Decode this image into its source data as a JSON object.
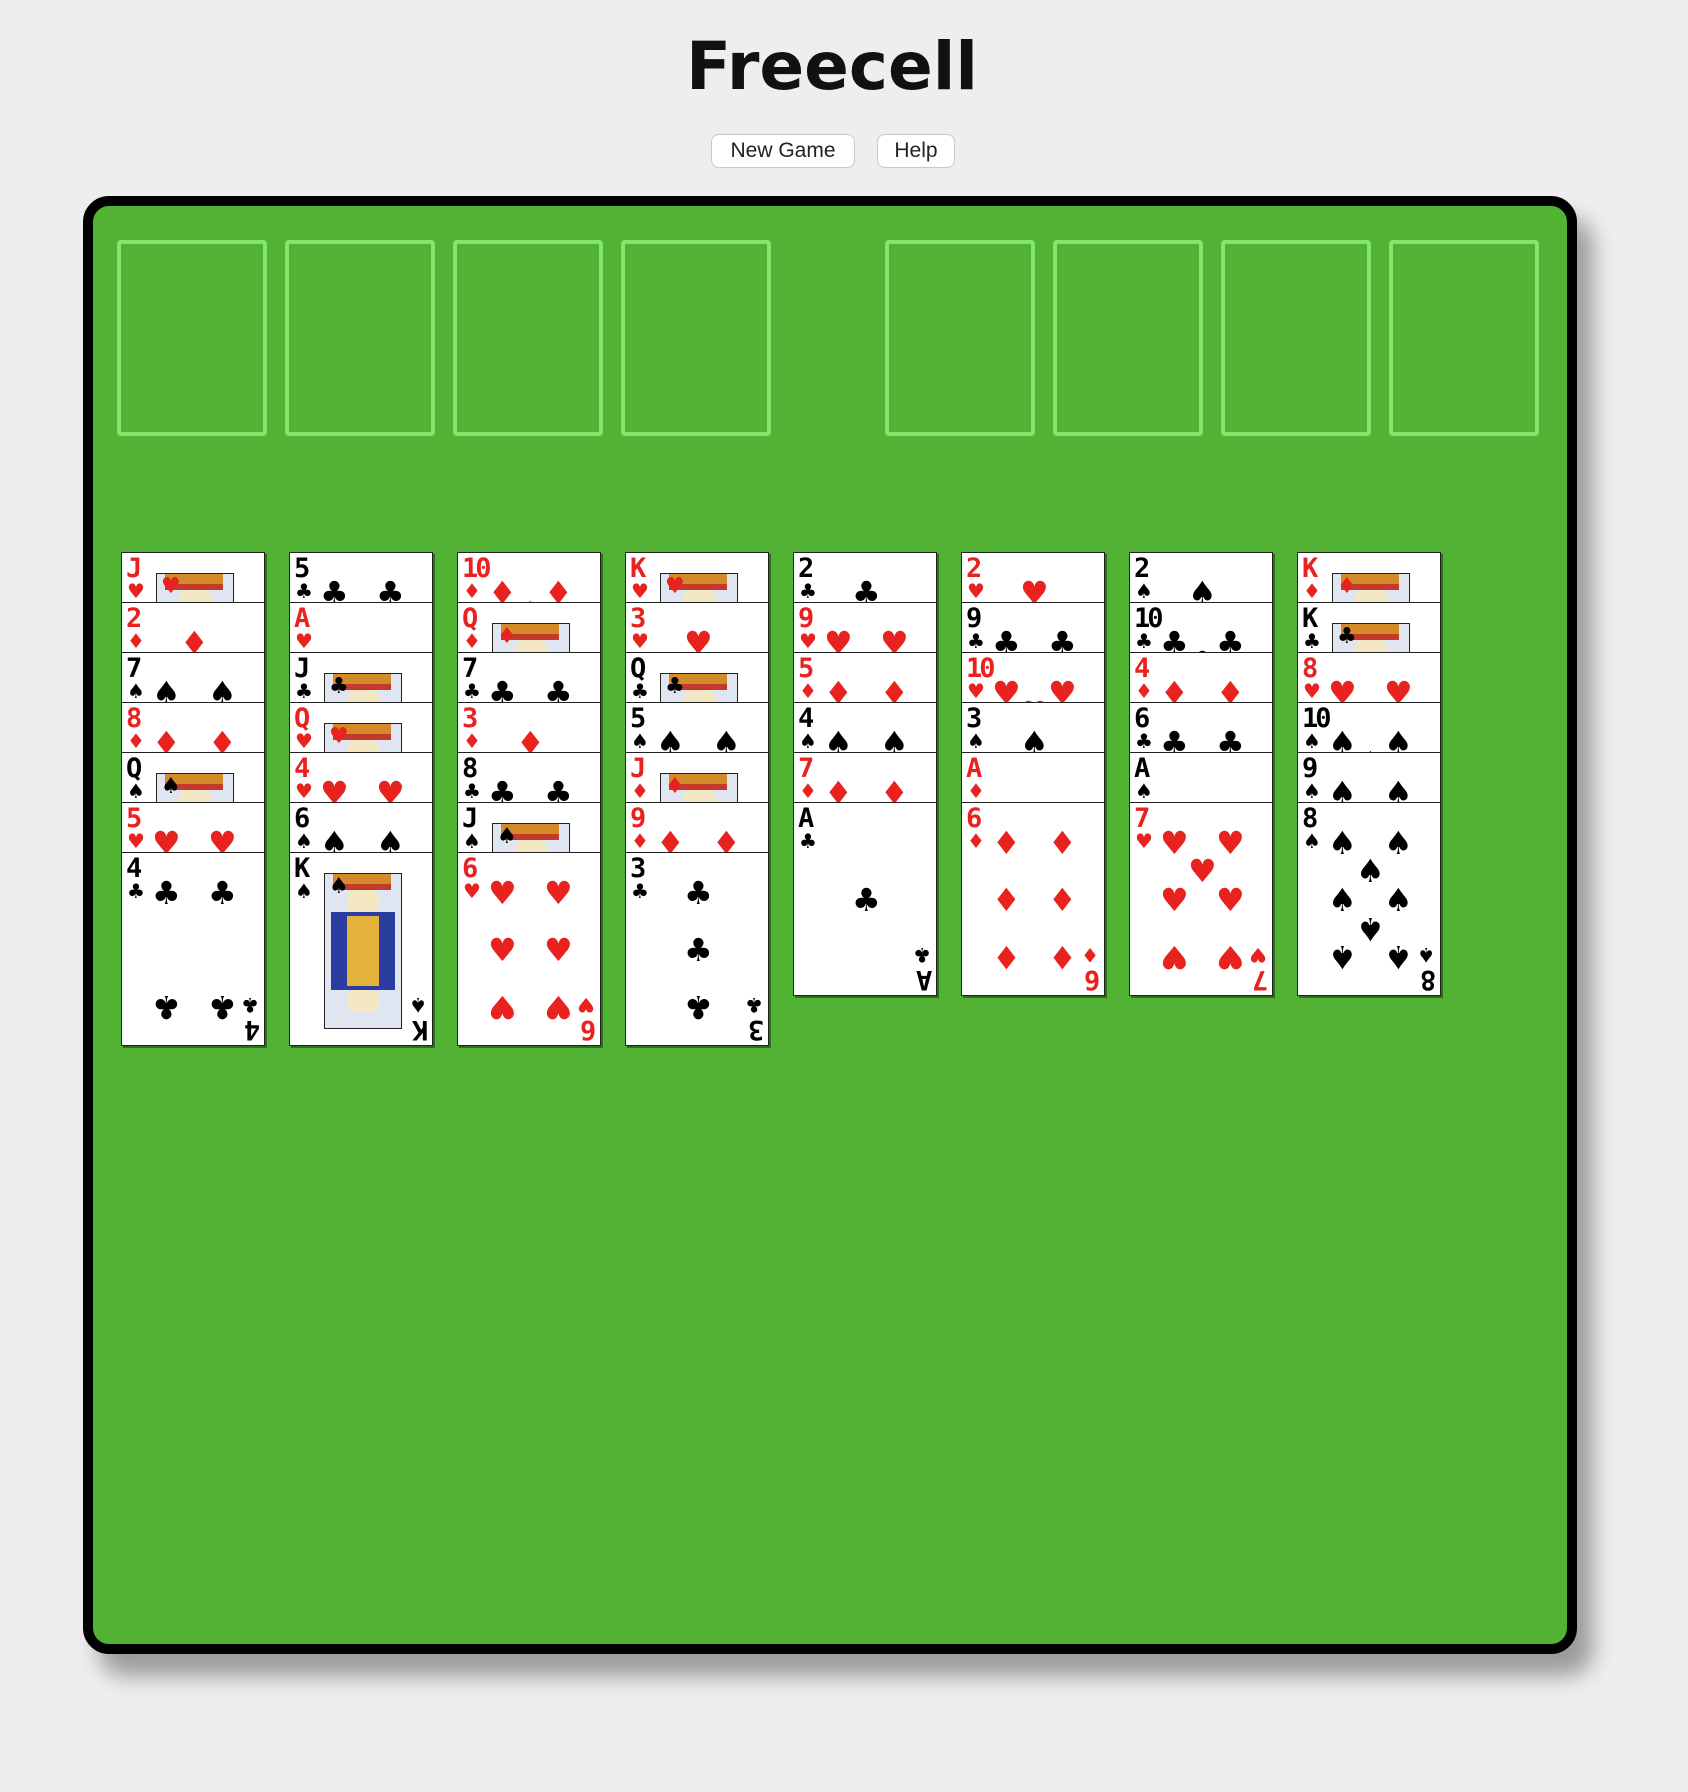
{
  "title": "Freecell",
  "buttons": {
    "new_game": "New Game",
    "help": "Help"
  },
  "free_cells": [
    {
      "name": "freecell-1"
    },
    {
      "name": "freecell-2"
    },
    {
      "name": "freecell-3"
    },
    {
      "name": "freecell-4"
    }
  ],
  "foundations": [
    {
      "name": "foundation-1"
    },
    {
      "name": "foundation-2"
    },
    {
      "name": "foundation-3"
    },
    {
      "name": "foundation-4"
    }
  ],
  "suit_glyphs": {
    "S": "♠",
    "H": "♥",
    "D": "♦",
    "C": "♣"
  },
  "colors": {
    "red": "#e8221e",
    "black": "#000000",
    "table": "#52b234",
    "slot_outline": "#82e66e"
  },
  "tableau": [
    [
      {
        "rank": "J",
        "suit": "H"
      },
      {
        "rank": "2",
        "suit": "D"
      },
      {
        "rank": "7",
        "suit": "S"
      },
      {
        "rank": "8",
        "suit": "D"
      },
      {
        "rank": "Q",
        "suit": "S"
      },
      {
        "rank": "5",
        "suit": "H"
      },
      {
        "rank": "4",
        "suit": "C"
      }
    ],
    [
      {
        "rank": "5",
        "suit": "C"
      },
      {
        "rank": "A",
        "suit": "H"
      },
      {
        "rank": "J",
        "suit": "C"
      },
      {
        "rank": "Q",
        "suit": "H"
      },
      {
        "rank": "4",
        "suit": "H"
      },
      {
        "rank": "6",
        "suit": "S"
      },
      {
        "rank": "K",
        "suit": "S"
      }
    ],
    [
      {
        "rank": "10",
        "suit": "D"
      },
      {
        "rank": "Q",
        "suit": "D"
      },
      {
        "rank": "7",
        "suit": "C"
      },
      {
        "rank": "3",
        "suit": "D"
      },
      {
        "rank": "8",
        "suit": "C"
      },
      {
        "rank": "J",
        "suit": "S"
      },
      {
        "rank": "6",
        "suit": "H"
      }
    ],
    [
      {
        "rank": "K",
        "suit": "H"
      },
      {
        "rank": "3",
        "suit": "H"
      },
      {
        "rank": "Q",
        "suit": "C"
      },
      {
        "rank": "5",
        "suit": "S"
      },
      {
        "rank": "J",
        "suit": "D"
      },
      {
        "rank": "9",
        "suit": "D"
      },
      {
        "rank": "3",
        "suit": "C"
      }
    ],
    [
      {
        "rank": "2",
        "suit": "C"
      },
      {
        "rank": "9",
        "suit": "H"
      },
      {
        "rank": "5",
        "suit": "D"
      },
      {
        "rank": "4",
        "suit": "S"
      },
      {
        "rank": "7",
        "suit": "D"
      },
      {
        "rank": "A",
        "suit": "C"
      }
    ],
    [
      {
        "rank": "2",
        "suit": "H"
      },
      {
        "rank": "9",
        "suit": "C"
      },
      {
        "rank": "10",
        "suit": "H"
      },
      {
        "rank": "3",
        "suit": "S"
      },
      {
        "rank": "A",
        "suit": "D"
      },
      {
        "rank": "6",
        "suit": "D"
      }
    ],
    [
      {
        "rank": "2",
        "suit": "S"
      },
      {
        "rank": "10",
        "suit": "C"
      },
      {
        "rank": "4",
        "suit": "D"
      },
      {
        "rank": "6",
        "suit": "C"
      },
      {
        "rank": "A",
        "suit": "S"
      },
      {
        "rank": "7",
        "suit": "H"
      }
    ],
    [
      {
        "rank": "K",
        "suit": "D"
      },
      {
        "rank": "K",
        "suit": "C"
      },
      {
        "rank": "8",
        "suit": "H"
      },
      {
        "rank": "10",
        "suit": "S"
      },
      {
        "rank": "9",
        "suit": "S"
      },
      {
        "rank": "8",
        "suit": "S"
      }
    ]
  ]
}
